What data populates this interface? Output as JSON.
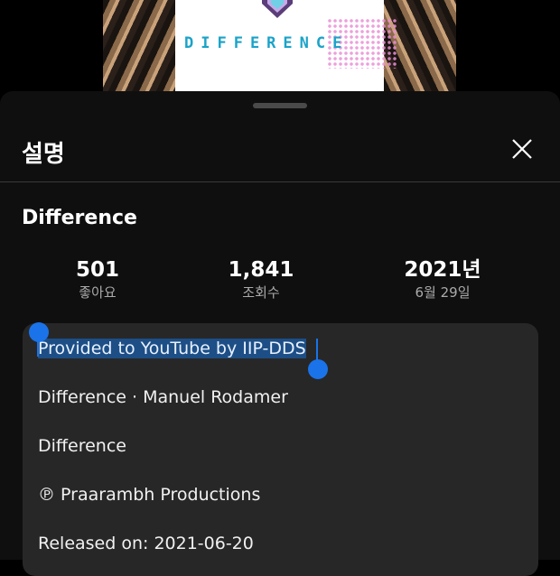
{
  "video": {
    "logo_text": "DIFFERENCE"
  },
  "sheet": {
    "title": "설명",
    "close_icon": "close-icon"
  },
  "details": {
    "title": "Difference",
    "stats": [
      {
        "value": "501",
        "label": "좋아요"
      },
      {
        "value": "1,841",
        "label": "조회수"
      },
      {
        "value": "2021년",
        "label": "6월 29일"
      }
    ]
  },
  "description": {
    "lines": [
      "Provided to YouTube by IIP-DDS",
      "Difference · Manuel Rodamer",
      "Difference",
      "℗ Praarambh Productions",
      "Released on: 2021-06-20"
    ],
    "selected_line_index": 0
  },
  "colors": {
    "selection_handle": "#1a73e8",
    "selection_highlight": "#1d4f86",
    "logo_text": "#1aa3c9"
  }
}
